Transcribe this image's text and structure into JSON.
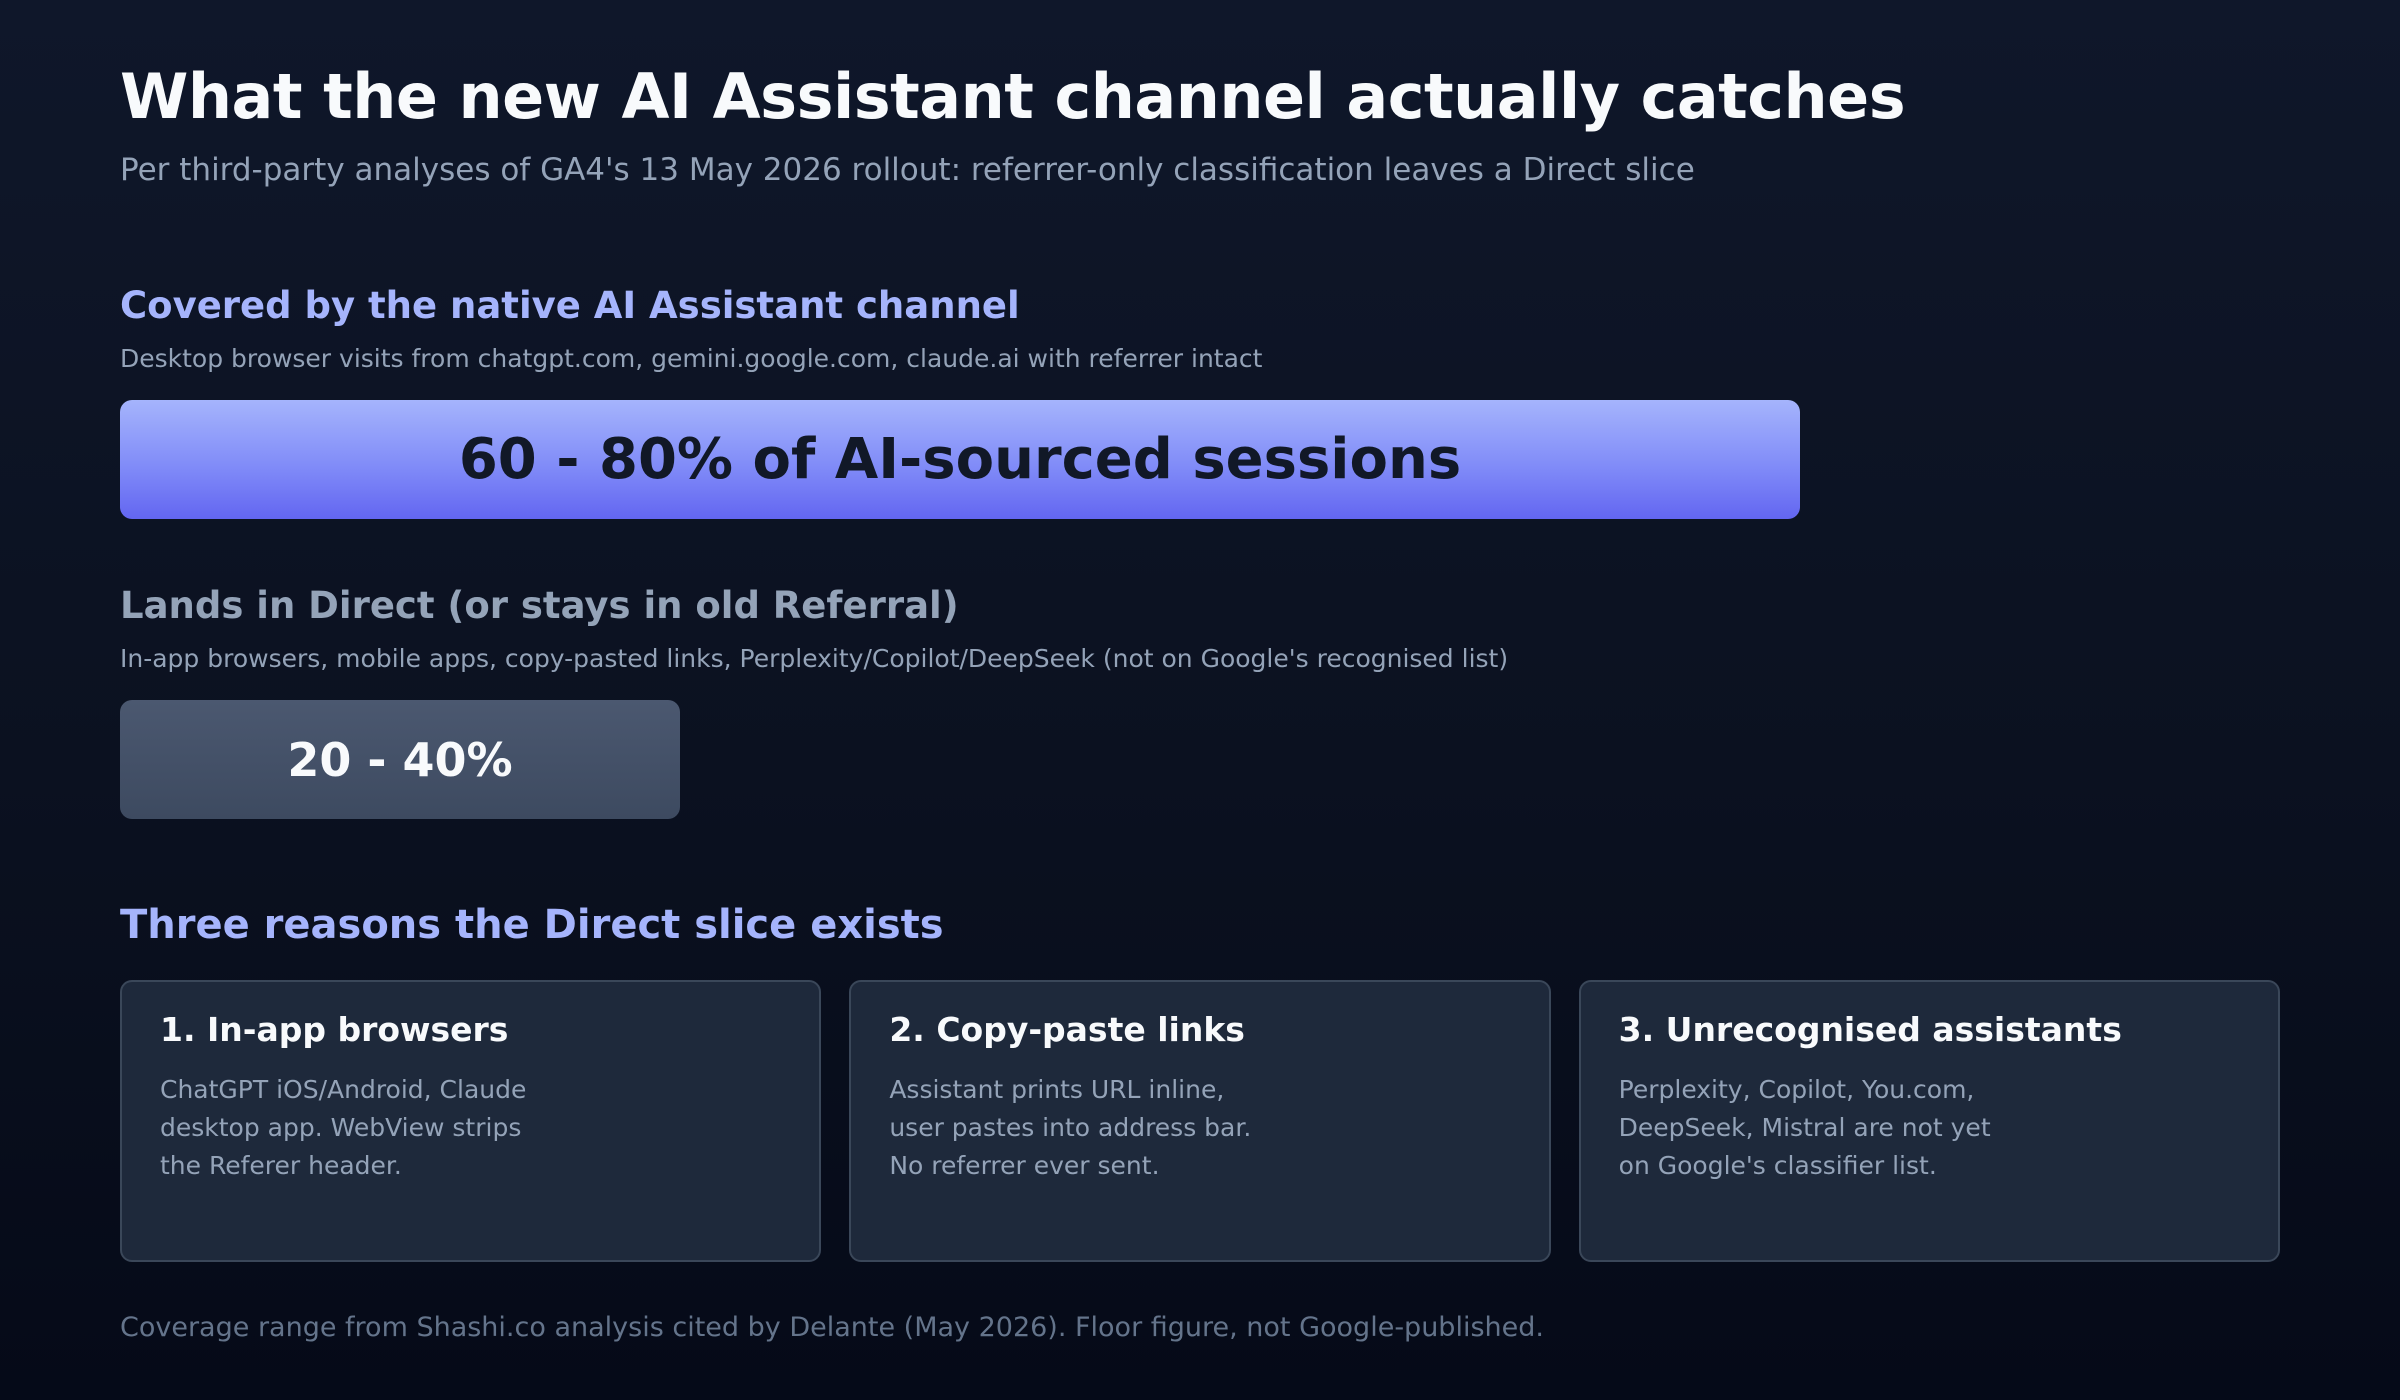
{
  "title": "What the new AI Assistant channel actually catches",
  "subtitle": "Per third-party analyses of GA4's 13 May 2026 rollout: referrer-only classification leaves a Direct slice",
  "covered": {
    "heading": "Covered by the native AI Assistant channel",
    "description": "Desktop browser visits from chatgpt.com, gemini.google.com, claude.ai with referrer intact",
    "bar_label": "60 - 80% of AI-sourced sessions",
    "range_low_pct": 60,
    "range_high_pct": 80,
    "color": "#818cf8"
  },
  "direct": {
    "heading": "Lands in Direct (or stays in old Referral)",
    "description": "In-app browsers, mobile apps, copy-pasted links, Perplexity/Copilot/DeepSeek (not on Google's recognised list)",
    "bar_label": "20 - 40%",
    "range_low_pct": 20,
    "range_high_pct": 40,
    "color": "#475569"
  },
  "reasons": {
    "heading": "Three reasons the Direct slice exists",
    "cards": [
      {
        "title": "1. In-app browsers",
        "lines": [
          "ChatGPT iOS/Android, Claude",
          "desktop app. WebView strips",
          "the Referer header."
        ]
      },
      {
        "title": "2. Copy-paste links",
        "lines": [
          "Assistant prints URL inline,",
          "user pastes into address bar.",
          "No referrer ever sent."
        ]
      },
      {
        "title": "3. Unrecognised assistants",
        "lines": [
          "Perplexity, Copilot, You.com,",
          "DeepSeek, Mistral are not yet",
          "on Google's classifier list."
        ]
      }
    ]
  },
  "footer": "Coverage range from Shashi.co analysis cited by Delante (May 2026). Floor figure, not Google-published.",
  "colors": {
    "background": "#0b1120",
    "accent": "#a5b4fc",
    "card_background": "#1e293b",
    "muted_text": "#94a3b8"
  }
}
